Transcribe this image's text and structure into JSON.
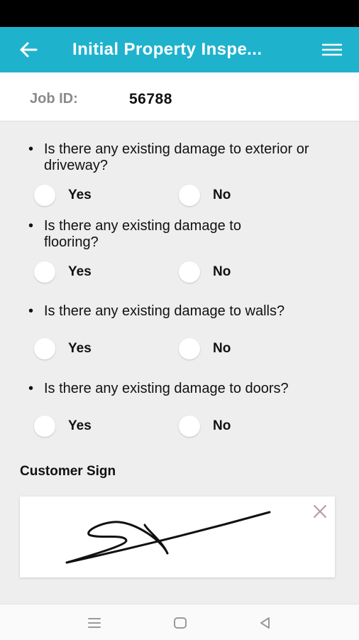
{
  "app_bar": {
    "title": "Initial Property Inspe...",
    "back_icon": "arrow-left-icon",
    "menu_icon": "hamburger-menu-icon",
    "color": "#1fb2cd"
  },
  "job": {
    "label": "Job ID:",
    "value": "56788"
  },
  "questions": [
    {
      "text": "Is there any existing damage to exterior or driveway?",
      "options": [
        "Yes",
        "No"
      ]
    },
    {
      "text": "Is there any existing damage to flooring?",
      "options": [
        "Yes",
        "No"
      ]
    },
    {
      "text": "Is there any existing damage to walls?",
      "options": [
        "Yes",
        "No"
      ]
    },
    {
      "text": "Is there any existing damage to doors?",
      "options": [
        "Yes",
        "No"
      ]
    }
  ],
  "bullet": "•",
  "signature": {
    "label": "Customer Sign",
    "clear_icon": "close-icon"
  },
  "nav": {
    "recent_icon": "recent-apps-icon",
    "home_icon": "home-icon",
    "back_icon": "back-triangle-icon"
  }
}
